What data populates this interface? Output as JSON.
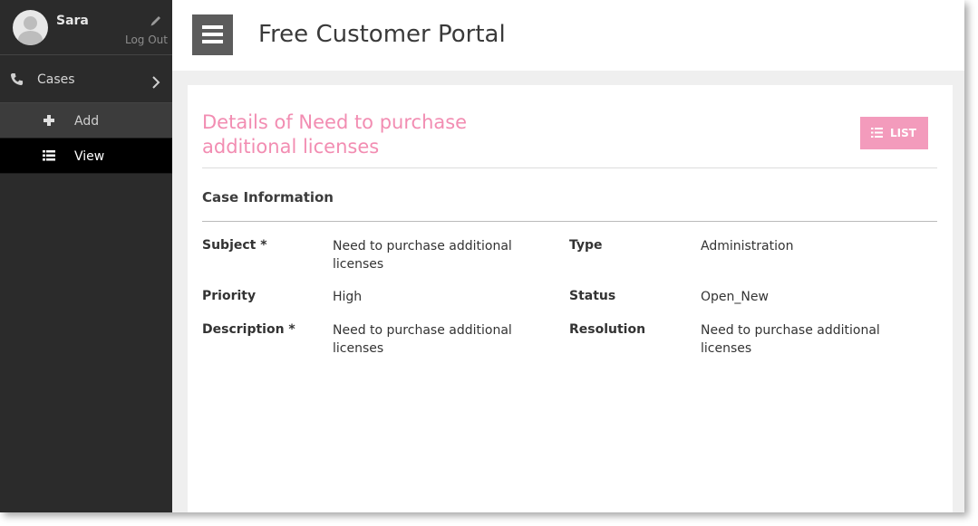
{
  "sidebar": {
    "username": "Sara",
    "logout_label": "Log Out",
    "nav": {
      "cases_label": "Cases",
      "add_label": "Add",
      "view_label": "View"
    }
  },
  "header": {
    "app_title": "Free Customer Portal"
  },
  "main": {
    "page_title": "Details of Need to purchase additional licenses",
    "list_button_label": "LIST",
    "section_title": "Case Information",
    "fields": {
      "subject": {
        "label": "Subject *",
        "value": "Need to purchase additional licenses"
      },
      "type": {
        "label": "Type",
        "value": "Administration"
      },
      "priority": {
        "label": "Priority",
        "value": "High"
      },
      "status": {
        "label": "Status",
        "value": "Open_New"
      },
      "description": {
        "label": "Description *",
        "value": "Need to purchase additional licenses"
      },
      "resolution": {
        "label": "Resolution",
        "value": "Need to purchase additional licenses"
      }
    }
  },
  "colors": {
    "accent_pink": "#f28db2",
    "button_pink": "#f39bbc",
    "sidebar_bg": "#2b2b2b",
    "active_nav_bg": "#000000"
  }
}
